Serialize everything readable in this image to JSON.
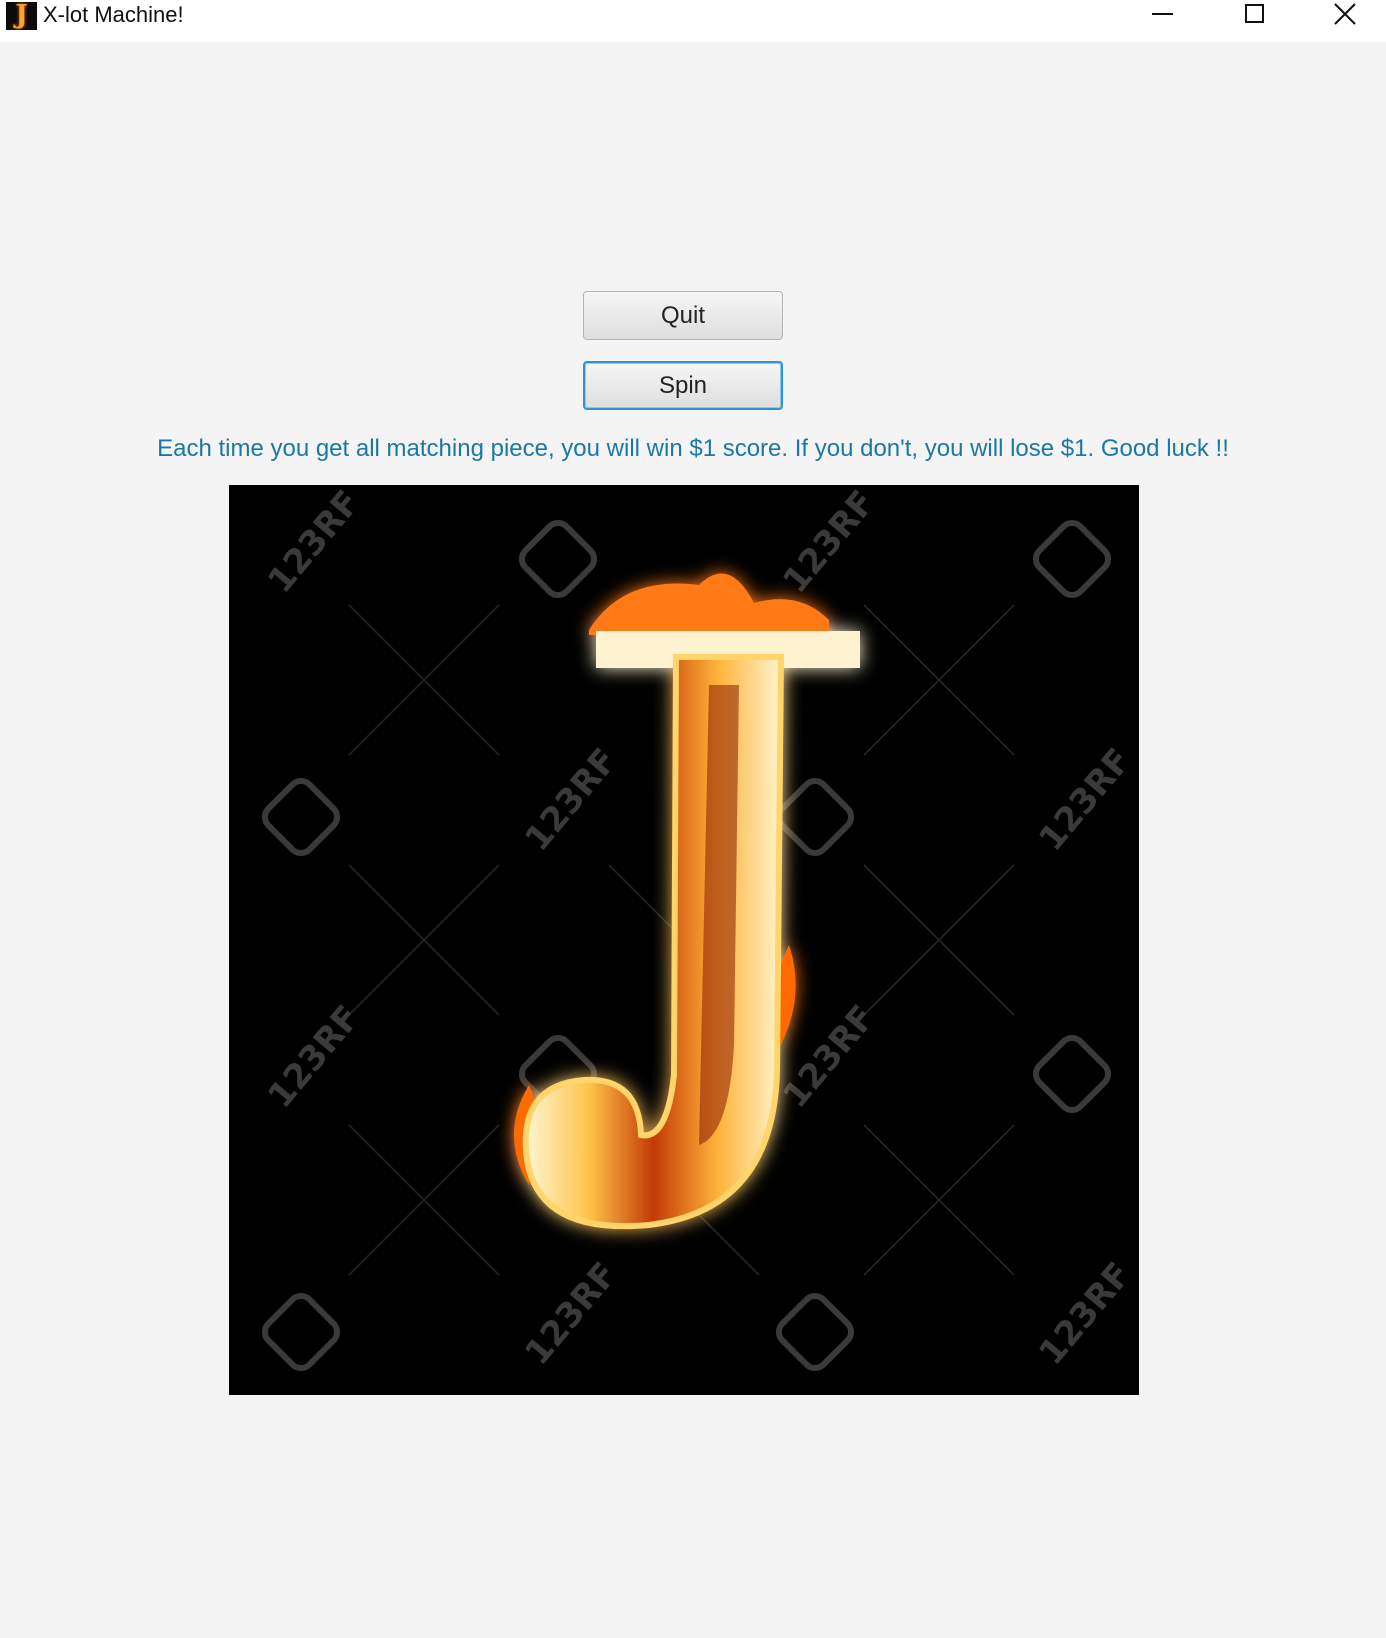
{
  "window": {
    "title": "X-lot Machine!",
    "icon": "flaming-j-icon",
    "controls": [
      "minimize-icon",
      "maximize-icon",
      "close-icon"
    ]
  },
  "buttons": {
    "quit_label": "Quit",
    "spin_label": "Spin"
  },
  "message": "Each time you get all matching piece, you will win $1 score. If you don't, you will lose $1. Good luck !!",
  "slot": {
    "symbol": "J",
    "watermark_text": "123RF",
    "colors": {
      "background": "#000000",
      "flame_outer": "#ff6a00",
      "flame_core": "#fff2c0"
    }
  },
  "colors": {
    "window_bg": "#f4f4f4",
    "message_text": "#1b78a6",
    "focus_border": "#2d94d6"
  }
}
